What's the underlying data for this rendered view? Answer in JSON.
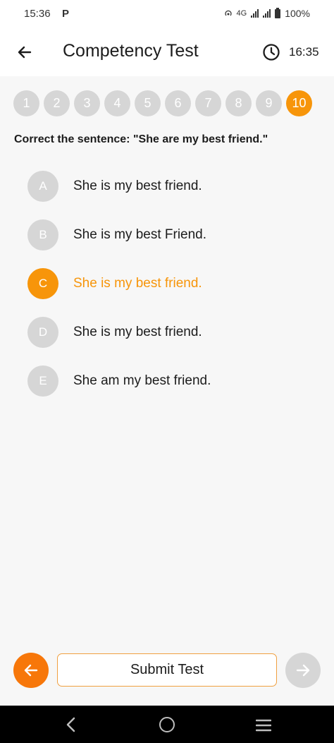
{
  "status_bar": {
    "time": "15:36",
    "app_icon": "P",
    "network": "4G",
    "battery": "100%"
  },
  "app_bar": {
    "title": "Competency Test",
    "timer": "16:35"
  },
  "pager": {
    "pages": [
      "1",
      "2",
      "3",
      "4",
      "5",
      "6",
      "7",
      "8",
      "9",
      "10"
    ],
    "active_index": 9
  },
  "question": {
    "text": "Correct the sentence: \"She are my best friend.\"",
    "options": [
      {
        "letter": "A",
        "text": "She is my best friend."
      },
      {
        "letter": "B",
        "text": "She is my best Friend."
      },
      {
        "letter": "C",
        "text": "She is my best friend."
      },
      {
        "letter": "D",
        "text": "She is my best friend."
      },
      {
        "letter": "E",
        "text": "She am my best friend."
      }
    ],
    "selected_index": 2
  },
  "footer": {
    "submit_label": "Submit Test"
  },
  "colors": {
    "accent": "#f7950a",
    "prev_button": "#f7770a",
    "inactive": "#d6d6d6",
    "background": "#f7f7f7"
  },
  "icons": {
    "back": "arrow-left-icon",
    "clock": "clock-icon",
    "prev": "arrow-left-icon",
    "next": "arrow-right-icon"
  }
}
